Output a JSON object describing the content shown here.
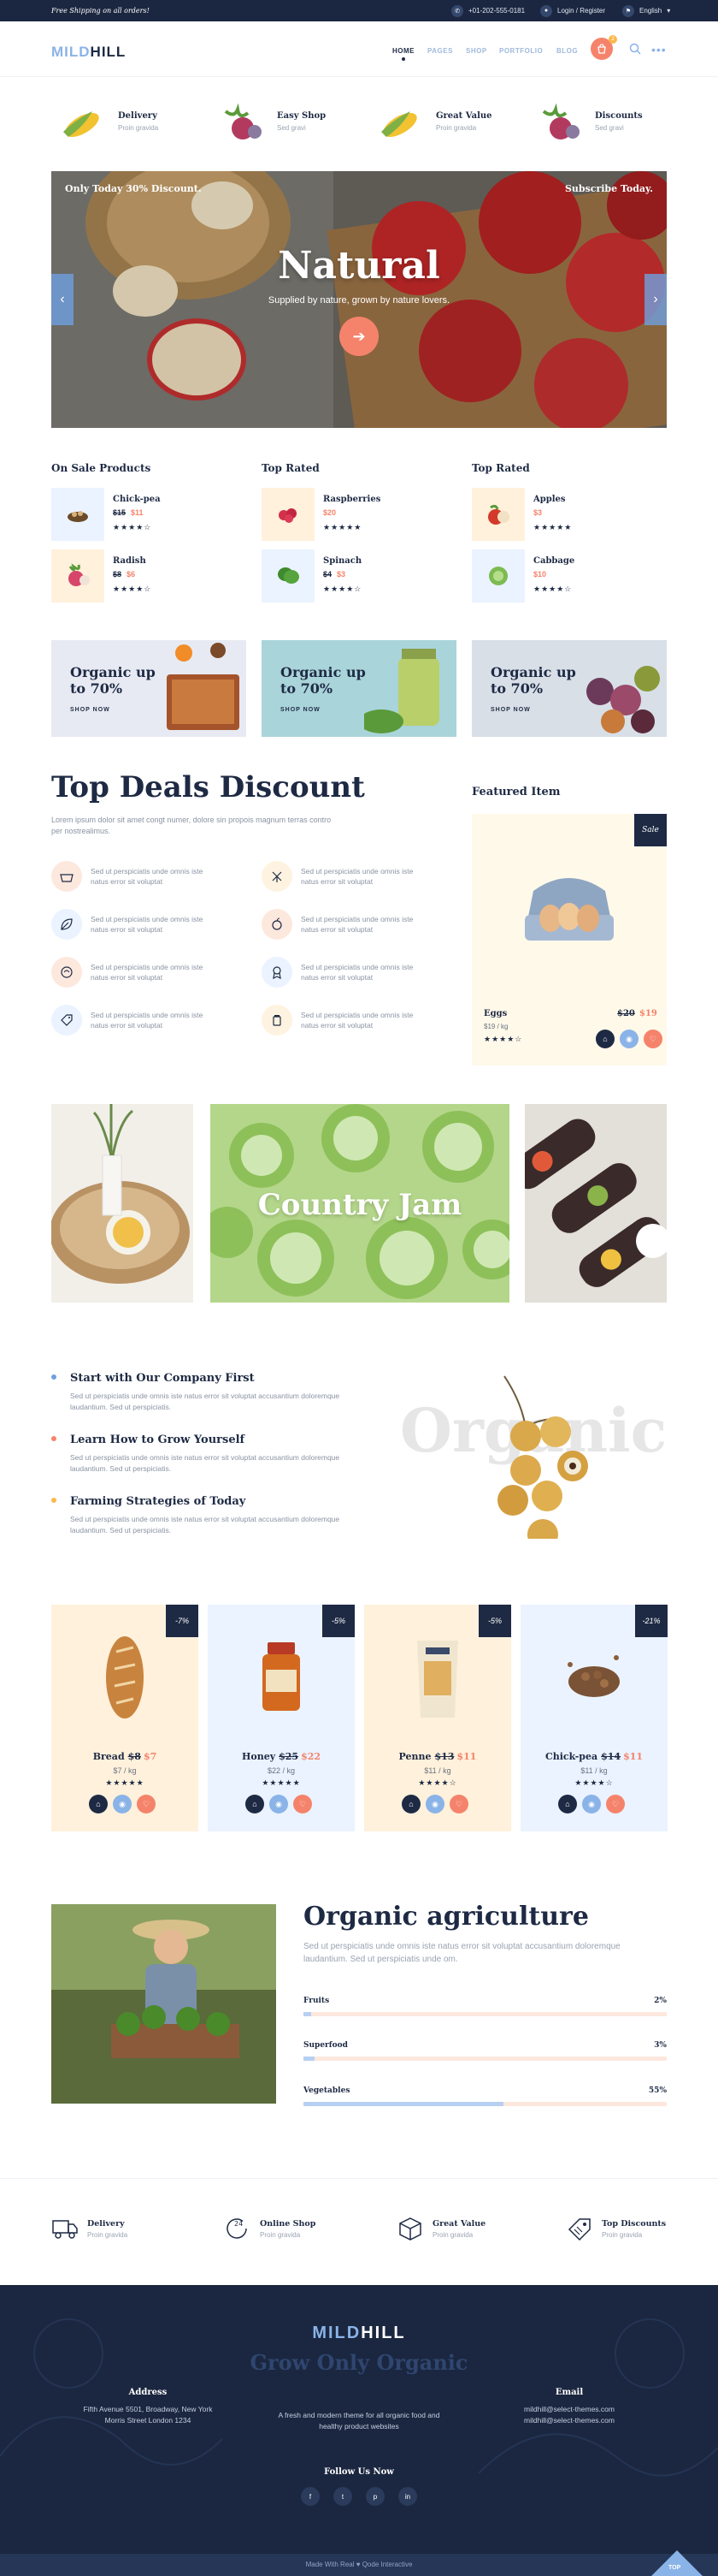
{
  "topbar": {
    "promo": "Free Shipping on all orders!",
    "phone": "+01-202-555-0181",
    "login": "Login / Register",
    "language": "English"
  },
  "header": {
    "logo_part1": "MILD",
    "logo_part2": "HILL",
    "nav": [
      "HOME",
      "PAGES",
      "SHOP",
      "PORTFOLIO",
      "BLOG"
    ],
    "cart_count": "2"
  },
  "features": [
    {
      "title": "Delivery",
      "sub": "Proin gravida"
    },
    {
      "title": "Easy Shop",
      "sub": "Sed gravi"
    },
    {
      "title": "Great Value",
      "sub": "Proin gravida"
    },
    {
      "title": "Discounts",
      "sub": "Sed gravi"
    }
  ],
  "hero": {
    "left_text": "Only Today 30% Discount.",
    "right_text": "Subscribe Today.",
    "title": "Natural",
    "subtitle": "Supplied by nature, grown by nature lovers.",
    "cta_icon": "arrow-right-icon"
  },
  "columns": {
    "on_sale": {
      "title": "On Sale Products",
      "items": [
        {
          "name": "Chick-pea",
          "old": "$15",
          "new": "$11",
          "stars": "★★★★☆"
        },
        {
          "name": "Radish",
          "old": "$8",
          "new": "$6",
          "stars": "★★★★☆"
        }
      ]
    },
    "top_rated_1": {
      "title": "Top Rated",
      "items": [
        {
          "name": "Raspberries",
          "old": "",
          "new": "$20",
          "stars": "★★★★★"
        },
        {
          "name": "Spinach",
          "old": "$4",
          "new": "$3",
          "stars": "★★★★☆"
        }
      ]
    },
    "top_rated_2": {
      "title": "Top Rated",
      "items": [
        {
          "name": "Apples",
          "old": "",
          "new": "$3",
          "stars": "★★★★★"
        },
        {
          "name": "Cabbage",
          "old": "",
          "new": "$10",
          "stars": "★★★★☆"
        }
      ]
    }
  },
  "promos": [
    {
      "title": "Organic up to 70%",
      "button": "SHOP NOW"
    },
    {
      "title": "Organic up to 70%",
      "button": "SHOP NOW"
    },
    {
      "title": "Organic up to 70%",
      "button": "SHOP NOW"
    }
  ],
  "deals": {
    "title": "Top Deals Discount",
    "desc": "Lorem ipsum dolor sit amet congt numer, dolore sin propois magnum terras contro per nostrealimus.",
    "items": [
      {
        "text": "Sed ut perspiciatis unde omnis iste natus error sit voluptat",
        "icon": "basket-icon"
      },
      {
        "text": "Sed ut perspiciatis unde omnis iste natus error sit voluptat",
        "icon": "windmill-icon"
      },
      {
        "text": "Sed ut perspiciatis unde omnis iste natus error sit voluptat",
        "icon": "leaf-icon"
      },
      {
        "text": "Sed ut perspiciatis unde omnis iste natus error sit voluptat",
        "icon": "apple-icon"
      },
      {
        "text": "Sed ut perspiciatis unde omnis iste natus error sit voluptat",
        "icon": "leaf-bowl-icon"
      },
      {
        "text": "Sed ut perspiciatis unde omnis iste natus error sit voluptat",
        "icon": "award-icon"
      },
      {
        "text": "Sed ut perspiciatis unde omnis iste natus error sit voluptat",
        "icon": "tag-icon"
      },
      {
        "text": "Sed ut perspiciatis unde omnis iste natus error sit voluptat",
        "icon": "jar-icon"
      }
    ]
  },
  "featured": {
    "heading": "Featured Item",
    "tag": "Sale",
    "name": "Eggs",
    "unit": "$19 / kg",
    "old": "$20",
    "new": "$19",
    "stars": "★★★★☆"
  },
  "gallery": {
    "title": "Country Jam"
  },
  "tips": [
    {
      "title": "Start with Our Company First",
      "desc": "Sed ut perspiciatis unde omnis iste natus error sit voluptat accusantium doloremque laudantium. Sed ut perspiciatis.",
      "color": "#6fa0e0"
    },
    {
      "title": "Learn How to Grow Yourself",
      "desc": "Sed ut perspiciatis unde omnis iste natus error sit voluptat accusantium doloremque laudantium. Sed ut perspiciatis.",
      "color": "#f5836b"
    },
    {
      "title": "Farming Strategies of Today",
      "desc": "Sed ut perspiciatis unde omnis iste natus error sit voluptat accusantium doloremque laudantium. Sed ut perspiciatis.",
      "color": "#fbb84d"
    }
  ],
  "organic_word": "Organic",
  "products": [
    {
      "name": "Bread",
      "old": "$8",
      "new": "$7",
      "unit": "$7 / kg",
      "stars": "★★★★★",
      "discount": "-7%",
      "bg": "#fff1dc"
    },
    {
      "name": "Honey",
      "old": "$25",
      "new": "$22",
      "unit": "$22 / kg",
      "stars": "★★★★★",
      "discount": "-5%",
      "bg": "#eaf3ff"
    },
    {
      "name": "Penne",
      "old": "$13",
      "new": "$11",
      "unit": "$11 / kg",
      "stars": "★★★★☆",
      "discount": "-5%",
      "bg": "#fff1dc"
    },
    {
      "name": "Chick-pea",
      "old": "$14",
      "new": "$11",
      "unit": "$11 / kg",
      "stars": "★★★★☆",
      "discount": "-21%",
      "bg": "#eaf3ff"
    }
  ],
  "agriculture": {
    "title": "Organic agriculture",
    "desc": "Sed ut perspiciatis unde omnis iste natus error sit voluptat accusantium doloremque laudantium. Sed ut perspiciatis unde om.",
    "bars": [
      {
        "label": "Fruits",
        "value": "2%",
        "pct": 2
      },
      {
        "label": "Superfood",
        "value": "3%",
        "pct": 3
      },
      {
        "label": "Vegetables",
        "value": "55%",
        "pct": 55
      }
    ]
  },
  "bottom_features": [
    {
      "title": "Delivery",
      "sub": "Proin gravida",
      "icon": "truck-icon"
    },
    {
      "title": "Online Shop",
      "sub": "Proin gravida",
      "icon": "24h-icon"
    },
    {
      "title": "Great Value",
      "sub": "Proin gravida",
      "icon": "box-icon"
    },
    {
      "title": "Top Discounts",
      "sub": "Proin gravida",
      "icon": "tag-icon"
    }
  ],
  "footer": {
    "logo1": "MILD",
    "logo2": "HILL",
    "slogan": "Grow Only Organic",
    "address_title": "Address",
    "address1": "Fifth Avenue 5501, Broadway, New York",
    "address2": "Morris Street London 1234",
    "about": "A fresh and modern theme for all organic food and healthy product websites",
    "email_title": "Email",
    "email1": "mildhill@select-themes.com",
    "email2": "mildhill@select-themes.com",
    "follow": "Follow Us Now",
    "socials": [
      "f",
      "t",
      "p",
      "in"
    ],
    "bottom": "Made With Real ♥ Qode Interactive",
    "top": "TOP"
  }
}
